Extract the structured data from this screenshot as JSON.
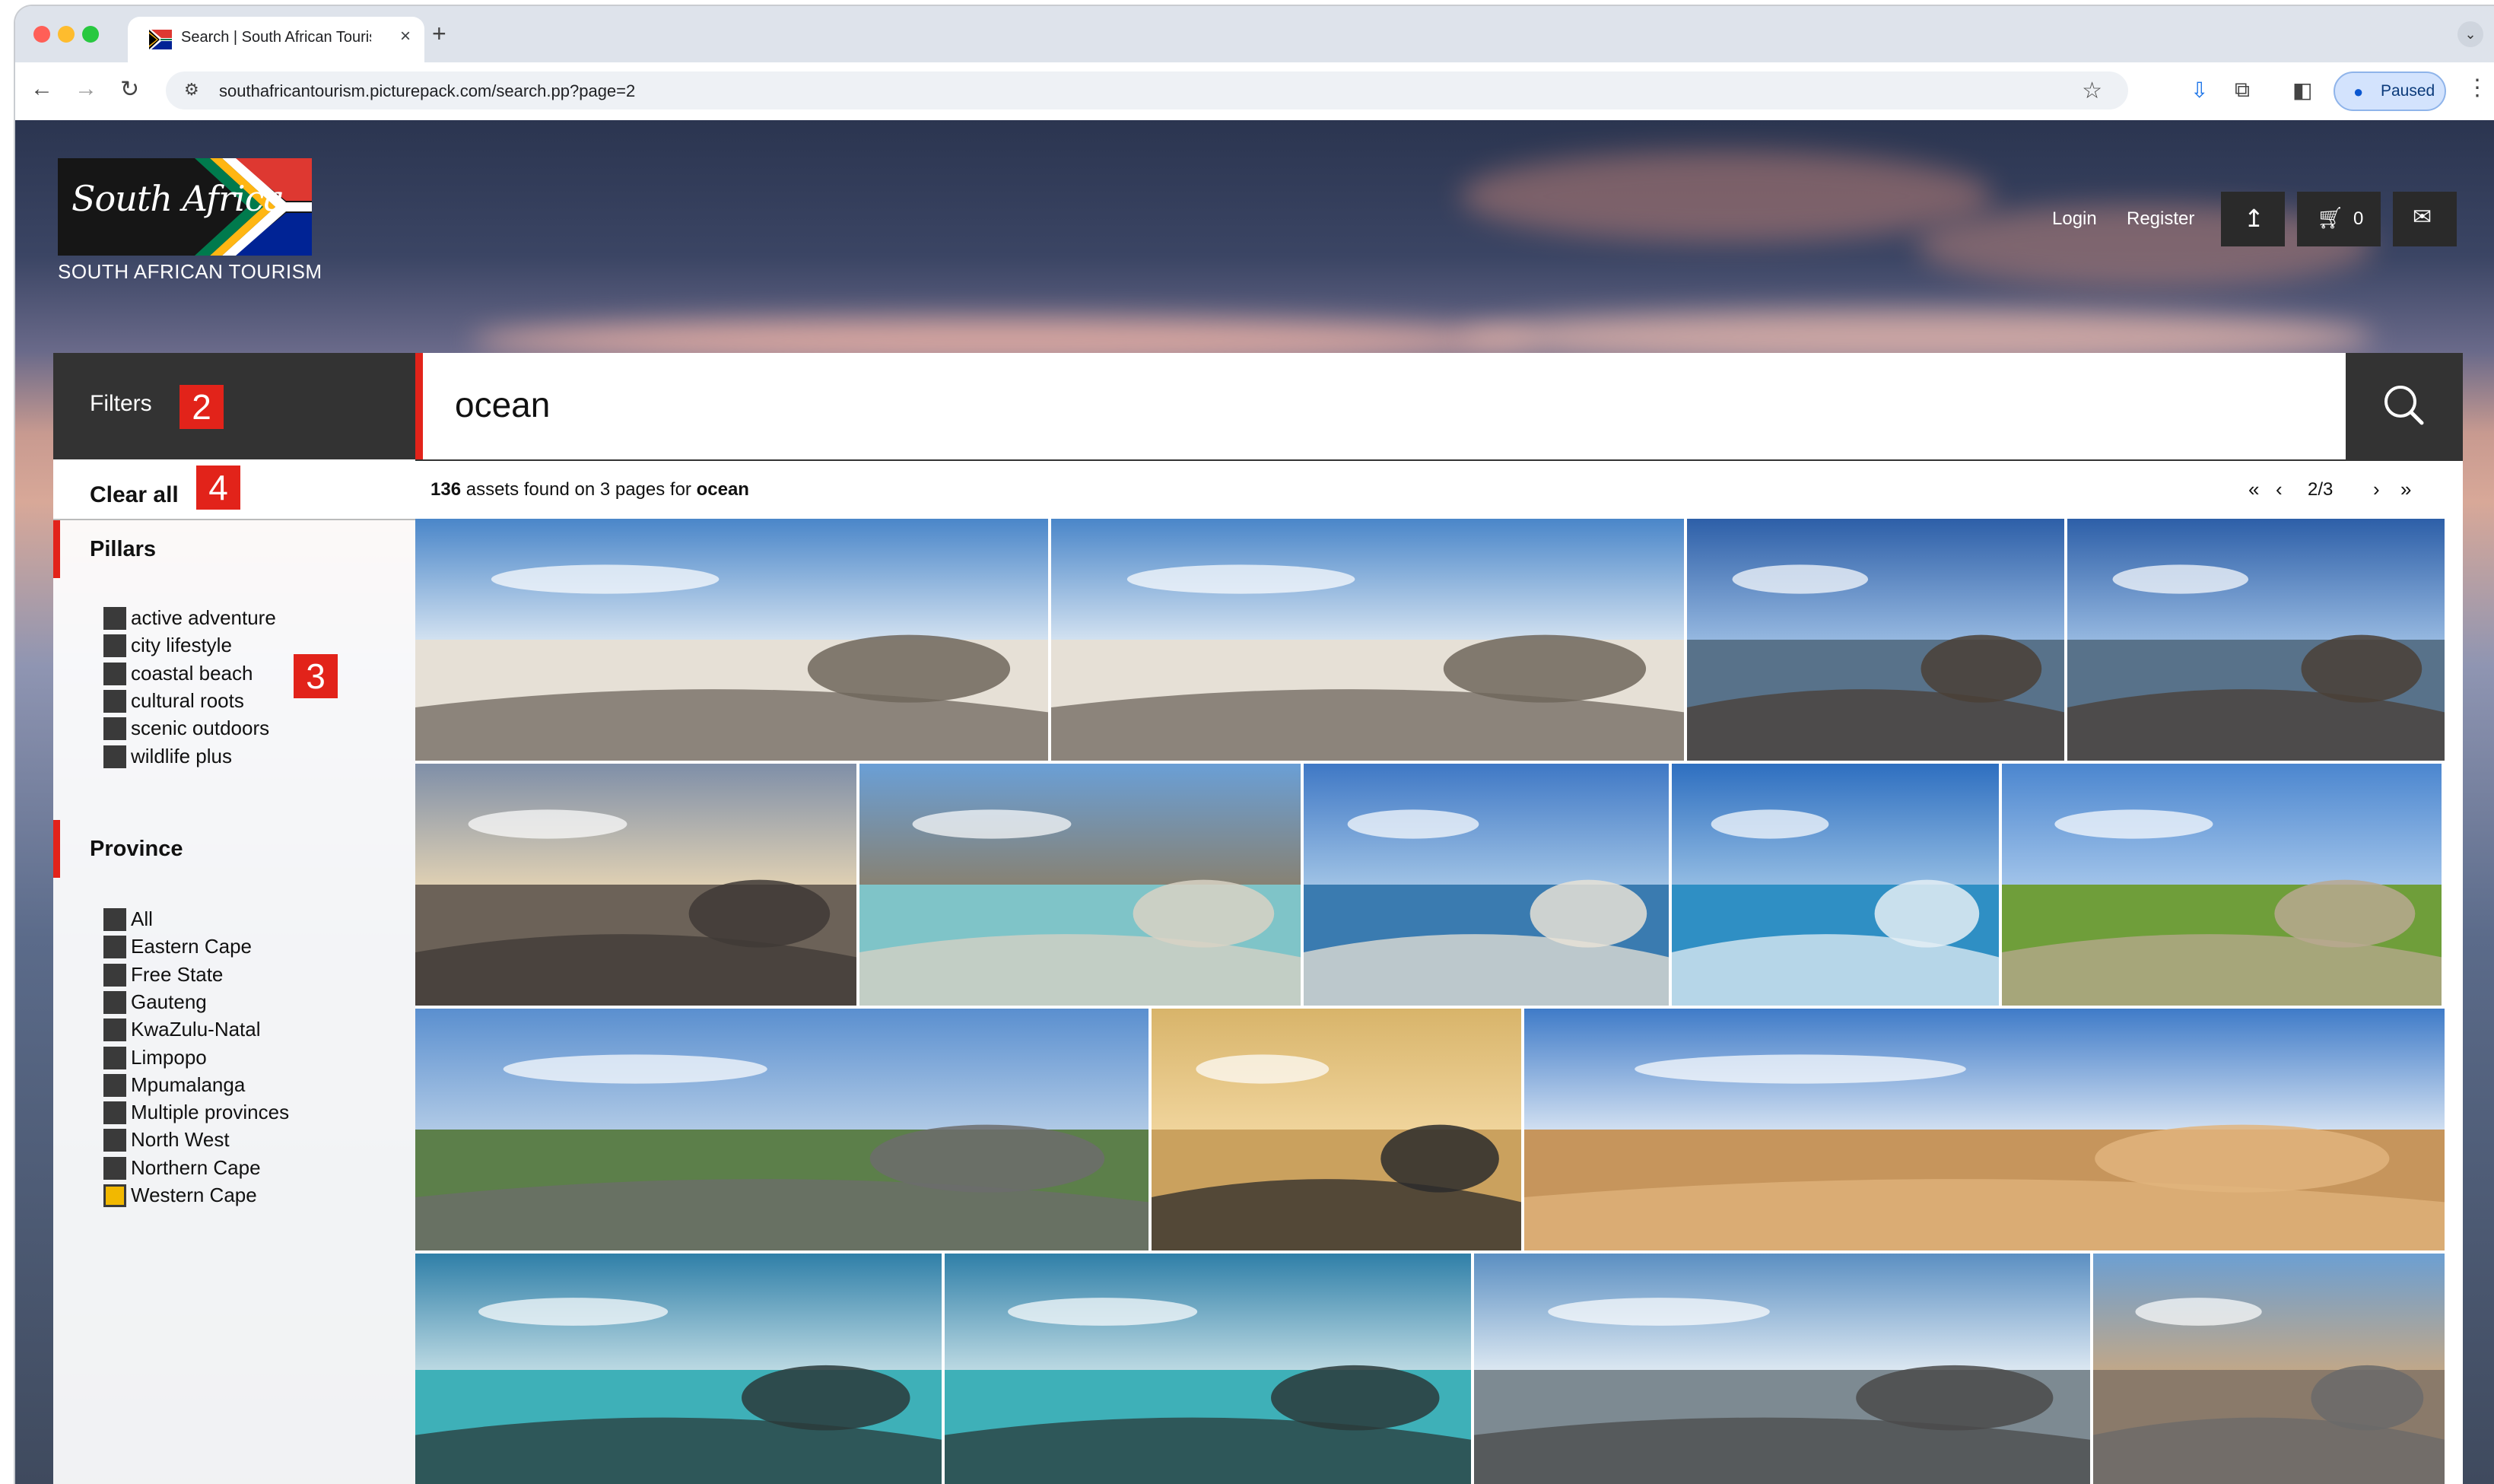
{
  "browser": {
    "tab_title": "Search | South African Touris",
    "new_tab": "+",
    "url": "southafricantourism.picturepack.com/search.pp?page=2",
    "profile_label": "Paused"
  },
  "header": {
    "logo_script": "South Africa",
    "logo_subtitle": "SOUTH AFRICAN TOURISM",
    "login": "Login",
    "register": "Register",
    "cart_count": "0"
  },
  "filters": {
    "title": "Filters",
    "clear_all": "Clear all",
    "annotations": [
      "2",
      "4",
      "3"
    ],
    "pillars": {
      "title": "Pillars",
      "items": [
        "active adventure",
        "city lifestyle",
        "coastal beach",
        "cultural roots",
        "scenic outdoors",
        "wildlife plus"
      ]
    },
    "province": {
      "title": "Province",
      "items": [
        "All",
        "Eastern Cape",
        "Free State",
        "Gauteng",
        "KwaZulu-Natal",
        "Limpopo",
        "Mpumalanga",
        "Multiple provinces",
        "North West",
        "Northern Cape",
        "Western Cape"
      ],
      "checked": "Western Cape"
    }
  },
  "search": {
    "query": "ocean"
  },
  "results": {
    "count": "136",
    "text_mid": " assets found on 3 pages for ",
    "query": "ocean",
    "page": "2/3"
  },
  "colors": {
    "accent_red": "#e2231a",
    "dark": "#333333",
    "checked_yellow": "#f2b800"
  }
}
